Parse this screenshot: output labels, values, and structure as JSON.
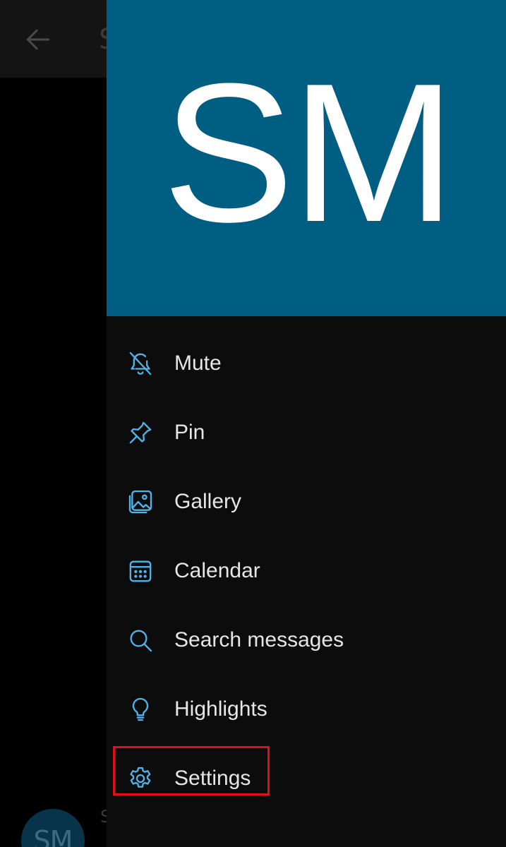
{
  "background": {
    "title_fragment": "S",
    "avatar_initials": "SM",
    "name_fragment": "S"
  },
  "drawer": {
    "header": {
      "initials": "SM",
      "color": "#005e83"
    },
    "accent_color": "#4fb3e8",
    "items": [
      {
        "label": "Mute",
        "icon": "bell-off-icon"
      },
      {
        "label": "Pin",
        "icon": "pin-icon"
      },
      {
        "label": "Gallery",
        "icon": "gallery-icon"
      },
      {
        "label": "Calendar",
        "icon": "calendar-icon"
      },
      {
        "label": "Search messages",
        "icon": "search-icon"
      },
      {
        "label": "Highlights",
        "icon": "lightbulb-icon"
      },
      {
        "label": "Settings",
        "icon": "gear-icon",
        "highlighted": true
      }
    ]
  }
}
